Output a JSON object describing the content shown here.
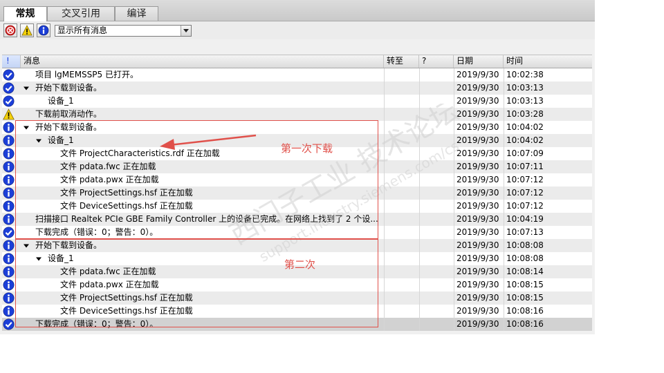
{
  "tabs": [
    {
      "label": "常规",
      "active": true
    },
    {
      "label": "交叉引用",
      "active": false
    },
    {
      "label": "编译",
      "active": false
    }
  ],
  "toolbar": {
    "filter_value": "显示所有消息",
    "icons": [
      "error-filter-icon",
      "warning-filter-icon",
      "info-filter-icon",
      "dropdown-arrow-icon"
    ]
  },
  "columns": {
    "status": "!",
    "message": "消息",
    "goto": "转至",
    "help": "?",
    "date": "日期",
    "time": "时间"
  },
  "rows": [
    {
      "icon": "check",
      "expander": "",
      "indent": 0,
      "message": "项目 lgMEMSSP5 已打开。",
      "date": "2019/9/30",
      "time": "10:02:38"
    },
    {
      "icon": "check",
      "expander": "down",
      "indent": 0,
      "message": "开始下载到设备。",
      "date": "2019/9/30",
      "time": "10:03:13"
    },
    {
      "icon": "check",
      "expander": "",
      "indent": 1,
      "message": "设备_1",
      "date": "2019/9/30",
      "time": "10:03:13"
    },
    {
      "icon": "warning",
      "expander": "",
      "indent": 0,
      "message": "下载前取消动作。",
      "date": "2019/9/30",
      "time": "10:03:28"
    },
    {
      "icon": "info",
      "expander": "down",
      "indent": 0,
      "message": "开始下载到设备。",
      "date": "2019/9/30",
      "time": "10:04:02"
    },
    {
      "icon": "info",
      "expander": "down",
      "indent": 1,
      "message": "设备_1",
      "date": "2019/9/30",
      "time": "10:04:02"
    },
    {
      "icon": "info",
      "expander": "",
      "indent": 2,
      "message": "文件 ProjectCharacteristics.rdf 正在加载",
      "date": "2019/9/30",
      "time": "10:07:09"
    },
    {
      "icon": "info",
      "expander": "",
      "indent": 2,
      "message": "文件 pdata.fwc 正在加载",
      "date": "2019/9/30",
      "time": "10:07:11"
    },
    {
      "icon": "info",
      "expander": "",
      "indent": 2,
      "message": "文件 pdata.pwx 正在加载",
      "date": "2019/9/30",
      "time": "10:07:12"
    },
    {
      "icon": "info",
      "expander": "",
      "indent": 2,
      "message": "文件 ProjectSettings.hsf 正在加载",
      "date": "2019/9/30",
      "time": "10:07:12"
    },
    {
      "icon": "info",
      "expander": "",
      "indent": 2,
      "message": "文件 DeviceSettings.hsf 正在加载",
      "date": "2019/9/30",
      "time": "10:07:12"
    },
    {
      "icon": "info",
      "expander": "",
      "indent": 0,
      "message": "扫描接口 Realtek PCIe GBE Family Controller 上的设备已完成。在网络上找到了 2 个设...",
      "date": "2019/9/30",
      "time": "10:04:19"
    },
    {
      "icon": "check",
      "expander": "",
      "indent": 0,
      "message": "下载完成（错误：0；警告：0）。",
      "date": "2019/9/30",
      "time": "10:07:13"
    },
    {
      "icon": "info",
      "expander": "down",
      "indent": 0,
      "message": "开始下载到设备。",
      "date": "2019/9/30",
      "time": "10:08:08"
    },
    {
      "icon": "info",
      "expander": "down",
      "indent": 1,
      "message": "设备_1",
      "date": "2019/9/30",
      "time": "10:08:08"
    },
    {
      "icon": "info",
      "expander": "",
      "indent": 2,
      "message": "文件 pdata.fwc 正在加载",
      "date": "2019/9/30",
      "time": "10:08:14"
    },
    {
      "icon": "info",
      "expander": "",
      "indent": 2,
      "message": "文件 pdata.pwx 正在加载",
      "date": "2019/9/30",
      "time": "10:08:15"
    },
    {
      "icon": "info",
      "expander": "",
      "indent": 2,
      "message": "文件 ProjectSettings.hsf 正在加载",
      "date": "2019/9/30",
      "time": "10:08:15"
    },
    {
      "icon": "info",
      "expander": "",
      "indent": 2,
      "message": "文件 DeviceSettings.hsf 正在加载",
      "date": "2019/9/30",
      "time": "10:08:16"
    },
    {
      "icon": "check",
      "expander": "",
      "indent": 0,
      "message": "下载完成（错误：0；警告：0）。",
      "date": "2019/9/30",
      "time": "10:08:16",
      "selected": true
    }
  ],
  "annotations": {
    "first": "第一次下载",
    "second": "第二次"
  },
  "watermark": {
    "cn": "西门子工业 技术论坛",
    "url": "support.industry.siemens.com/cs"
  },
  "colors": {
    "annotation": "#e0504a",
    "info": "#1c3fd8",
    "warning": "#f5d20a",
    "error": "#d81e1e"
  }
}
